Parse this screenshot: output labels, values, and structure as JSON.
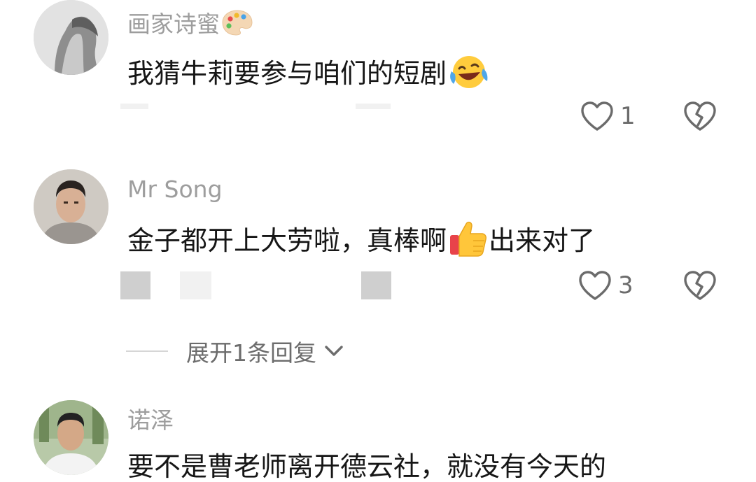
{
  "comments": [
    {
      "username": "画家诗蜜",
      "username_emoji": "palette-emoji",
      "text": "我猜牛莉要参与咱们的短剧",
      "text_emoji": "laughing-crying-emoji",
      "text_after": "",
      "likes": "1"
    },
    {
      "username": "Mr Song",
      "text": "金子都开上大劳啦，真棒啊",
      "text_emoji": "thumbs-up-emoji",
      "text_after": "出来对了",
      "likes": "3"
    },
    {
      "username": "诺泽",
      "text": "要不是曹老师离开德云社，就没有今天的"
    }
  ],
  "expand_replies": {
    "label": "展开1条回复"
  },
  "icons": {
    "like": "heart-outline-icon",
    "dislike": "broken-heart-icon",
    "expand": "chevron-down-icon"
  },
  "colors": {
    "username": "#9d9d9d",
    "text": "#161616",
    "icon": "#6b6b6b"
  }
}
